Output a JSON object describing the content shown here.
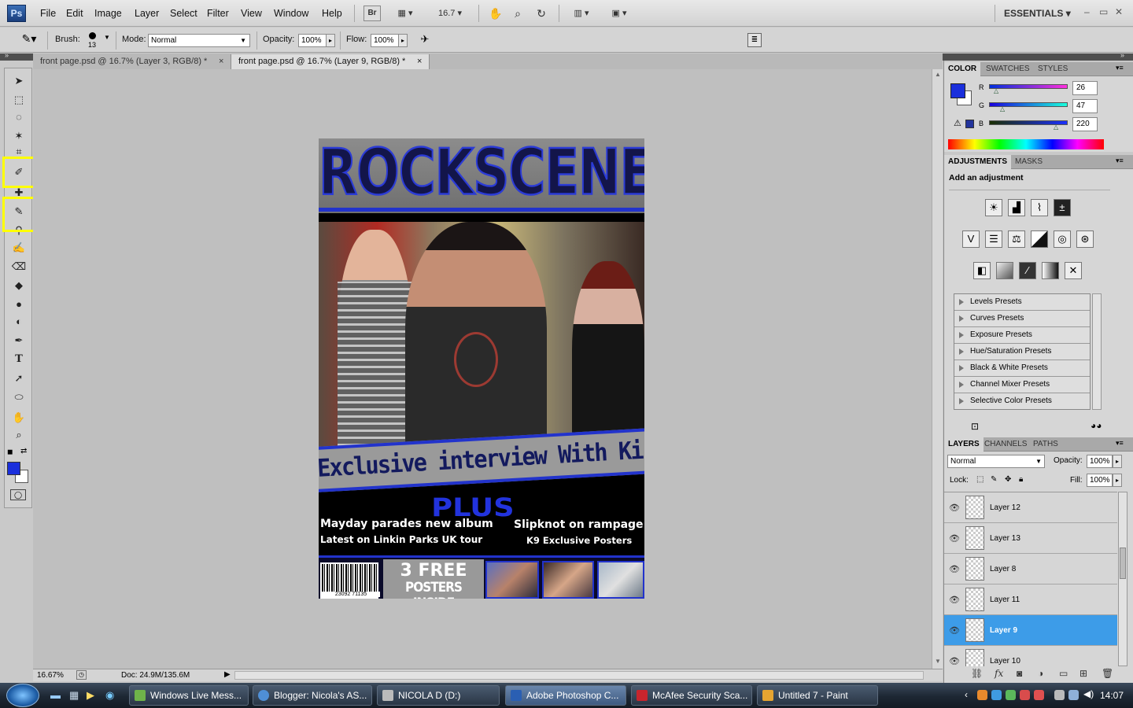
{
  "menubar": {
    "logo": "Ps",
    "items": [
      "File",
      "Edit",
      "Image",
      "Layer",
      "Select",
      "Filter",
      "View",
      "Window",
      "Help"
    ],
    "bridge": "Br",
    "zoom": "16.7",
    "workspace": "ESSENTIALS",
    "window_controls": [
      "–",
      "▭",
      "✕"
    ]
  },
  "options": {
    "brush_label": "Brush:",
    "brush_size": "13",
    "mode_label": "Mode:",
    "mode_value": "Normal",
    "opacity_label": "Opacity:",
    "opacity_value": "100%",
    "flow_label": "Flow:",
    "flow_value": "100%"
  },
  "tabs": [
    {
      "label": "front page.psd @ 16.7% (Layer 3, RGB/8) *"
    },
    {
      "label": "front page.psd @ 16.7% (Layer 9, RGB/8) *"
    }
  ],
  "artwork": {
    "masthead": "ROCKSCENE",
    "banner": "Exclusive interview With Kickflip",
    "plus": "PLUS",
    "cover_lines": [
      "Mayday parades new album",
      "Slipknot on rampage",
      "Latest on Linkin Parks UK tour",
      "K9 Exclusive Posters"
    ],
    "barcode_number": "23092 71135",
    "free_line1": "3 FREE",
    "free_line2": "POSTERS INSIDE"
  },
  "status": {
    "zoom": "16.67%",
    "doc": "Doc: 24.9M/135.6M"
  },
  "color_panel": {
    "tabs": [
      "COLOR",
      "SWATCHES",
      "STYLES"
    ],
    "r_label": "R",
    "g_label": "G",
    "b_label": "B",
    "r": "26",
    "g": "47",
    "b": "220",
    "foreground": "#1a2fdc"
  },
  "adjustments": {
    "tabs": [
      "ADJUSTMENTS",
      "MASKS"
    ],
    "heading": "Add an adjustment",
    "presets": [
      "Levels Presets",
      "Curves Presets",
      "Exposure Presets",
      "Hue/Saturation Presets",
      "Black & White Presets",
      "Channel Mixer Presets",
      "Selective Color Presets"
    ]
  },
  "layers_panel": {
    "tabs": [
      "LAYERS",
      "CHANNELS",
      "PATHS"
    ],
    "blend_mode": "Normal",
    "opacity_label": "Opacity:",
    "opacity_value": "100%",
    "lock_label": "Lock:",
    "fill_label": "Fill:",
    "fill_value": "100%",
    "layers": [
      {
        "name": "Layer 12"
      },
      {
        "name": "Layer 13"
      },
      {
        "name": "Layer 8"
      },
      {
        "name": "Layer 11"
      },
      {
        "name": "Layer 9"
      },
      {
        "name": "Layer 10"
      }
    ]
  },
  "taskbar": {
    "items": [
      {
        "label": "Windows Live Mess...",
        "color": "#6fb34a"
      },
      {
        "label": "Blogger: Nicola's AS...",
        "color": "#4f8fd6"
      },
      {
        "label": "NICOLA D (D:)",
        "color": "#bbbbbb"
      },
      {
        "label": "Adobe Photoshop C...",
        "color": "#2a5fb3"
      },
      {
        "label": "McAfee Security Sca...",
        "color": "#c8252d"
      },
      {
        "label": "Untitled 7 - Paint",
        "color": "#e6a531"
      }
    ],
    "clock": "14:07"
  }
}
